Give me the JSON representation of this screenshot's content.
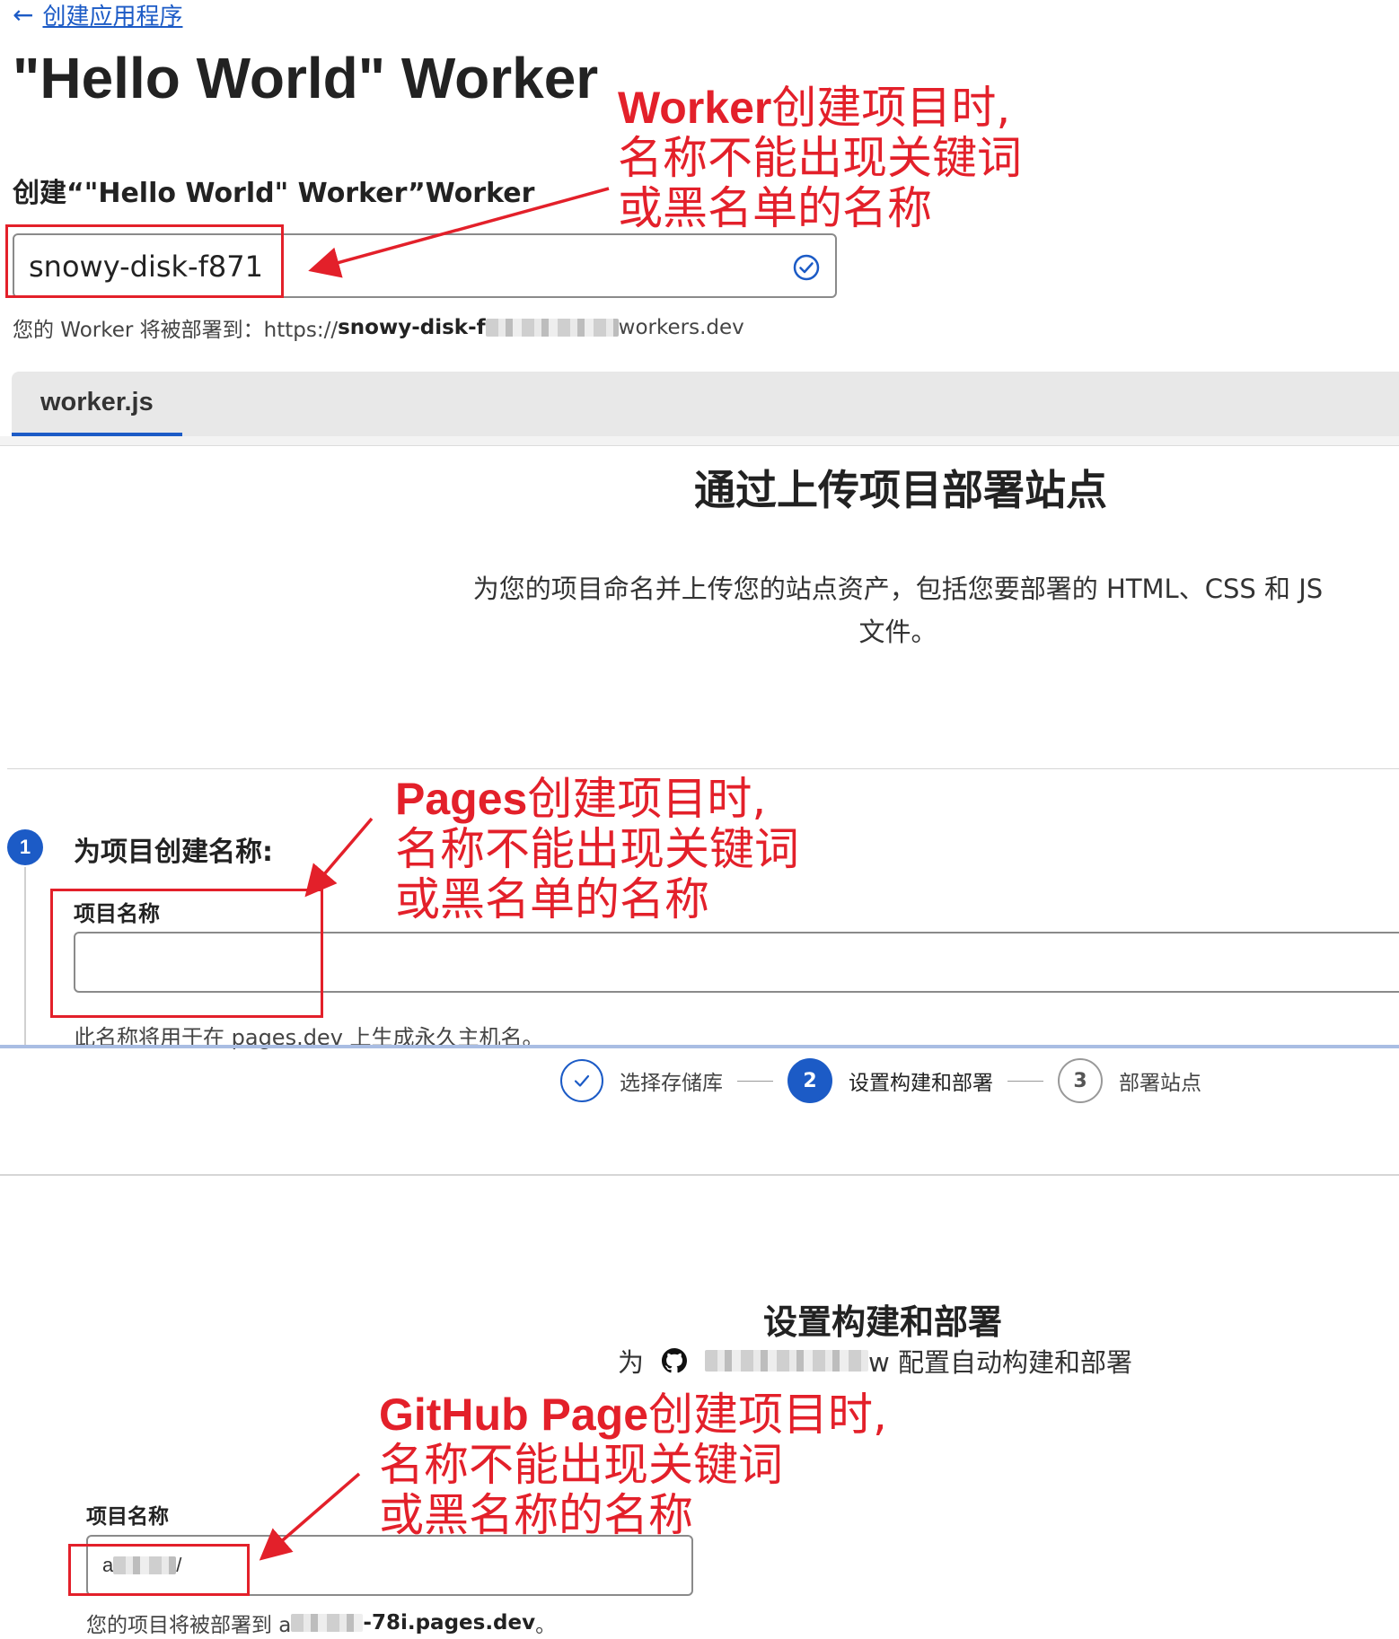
{
  "section1": {
    "back_link": "创建应用程序",
    "title": "\"Hello World\" Worker",
    "field_label": "创建“\"Hello World\" Worker”Worker",
    "input_value": "snowy-disk-f871",
    "deploy_prefix": "您的 Worker 将被部署到：https://",
    "deploy_bold": "snowy-disk-f",
    "deploy_suffix": "workers.dev",
    "tab_label": "worker.js",
    "annotation": {
      "bold": "Worker",
      "line1": "创建项目时,",
      "line2": "名称不能出现关键词",
      "line3": "或黑名单的名称"
    }
  },
  "section2": {
    "heading": "通过上传项目部署站点",
    "desc_line1": "为您的项目命名并上传您的站点资产，包括您要部署的 HTML、CSS 和 JS",
    "desc_line2": "文件。",
    "step_number": "1",
    "step_title": "为项目创建名称:",
    "field_label": "项目名称",
    "input_value": "",
    "help_text": "此名称将用于在 pages.dev 上生成永久主机名。",
    "annotation": {
      "bold": "Pages",
      "line1": "创建项目时,",
      "line2": "名称不能出现关键词",
      "line3": "或黑名单的名称"
    }
  },
  "section3": {
    "steps": [
      {
        "number": "",
        "label": "选择存储库",
        "state": "done"
      },
      {
        "number": "2",
        "label": "设置构建和部署",
        "state": "active"
      },
      {
        "number": "3",
        "label": "部署站点",
        "state": "pending"
      }
    ],
    "heading": "设置构建和部署",
    "sub_prefix": "为",
    "sub_suffix": "w 配置自动构建和部署",
    "field_label": "项目名称",
    "input_value_start": "a",
    "input_value_end": "/",
    "deploy_prefix": "您的项目将被部署到 a",
    "deploy_bold": "-78i.pages.dev",
    "deploy_suffix": "。",
    "annotation": {
      "bold": "GitHub Page",
      "line1": "创建项目时,",
      "line2": "名称不能出现关键词",
      "line3": "或黑名称的名称"
    }
  },
  "colors": {
    "accent_blue": "#1c5bc6",
    "annotation_red": "#e3202a",
    "valid_check": "#1c5bc6"
  },
  "icons": [
    "arrow-left-icon",
    "check-circle-icon",
    "check-icon",
    "github-icon"
  ]
}
